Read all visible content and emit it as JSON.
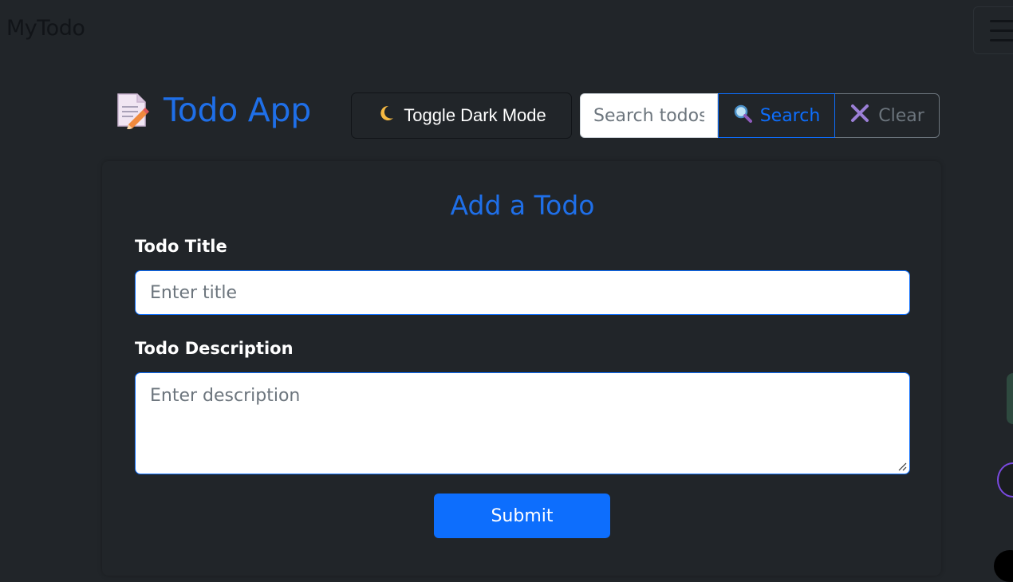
{
  "navbar": {
    "brand": "MyTodo",
    "menu_icon": "hamburger-menu-icon"
  },
  "header": {
    "app_icon": "memo-icon",
    "app_title": "Todo App",
    "toggle_dark_mode": {
      "icon": "crescent-moon-icon",
      "label": "Toggle Dark Mode"
    },
    "search": {
      "placeholder": "Search todos",
      "search_button": {
        "icon": "magnifier-icon",
        "label": "Search"
      },
      "clear_button": {
        "icon": "cross-icon",
        "label": "Clear"
      }
    }
  },
  "form": {
    "heading": "Add a Todo",
    "title_label": "Todo Title",
    "title_placeholder": "Enter title",
    "title_value": "",
    "description_label": "Todo Description",
    "description_placeholder": "Enter description",
    "description_value": "",
    "submit_label": "Submit"
  },
  "colors": {
    "background": "#212529",
    "accent": "#0d6efd",
    "heading": "#1f6fe8",
    "muted": "#6c757d"
  }
}
